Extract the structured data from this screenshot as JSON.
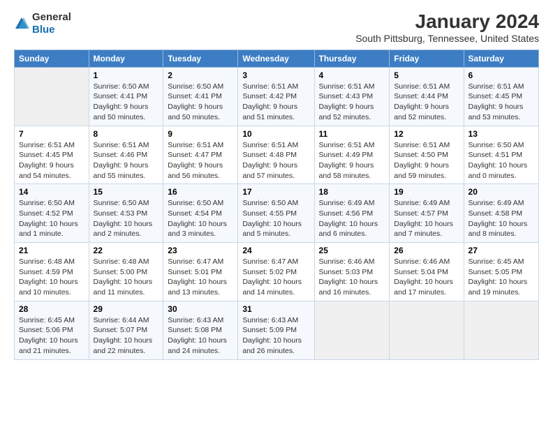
{
  "logo": {
    "general": "General",
    "blue": "Blue"
  },
  "title": "January 2024",
  "subtitle": "South Pittsburg, Tennessee, United States",
  "days_of_week": [
    "Sunday",
    "Monday",
    "Tuesday",
    "Wednesday",
    "Thursday",
    "Friday",
    "Saturday"
  ],
  "weeks": [
    [
      {
        "num": "",
        "sunrise": "",
        "sunset": "",
        "daylight": ""
      },
      {
        "num": "1",
        "sunrise": "Sunrise: 6:50 AM",
        "sunset": "Sunset: 4:41 PM",
        "daylight": "Daylight: 9 hours and 50 minutes."
      },
      {
        "num": "2",
        "sunrise": "Sunrise: 6:50 AM",
        "sunset": "Sunset: 4:41 PM",
        "daylight": "Daylight: 9 hours and 50 minutes."
      },
      {
        "num": "3",
        "sunrise": "Sunrise: 6:51 AM",
        "sunset": "Sunset: 4:42 PM",
        "daylight": "Daylight: 9 hours and 51 minutes."
      },
      {
        "num": "4",
        "sunrise": "Sunrise: 6:51 AM",
        "sunset": "Sunset: 4:43 PM",
        "daylight": "Daylight: 9 hours and 52 minutes."
      },
      {
        "num": "5",
        "sunrise": "Sunrise: 6:51 AM",
        "sunset": "Sunset: 4:44 PM",
        "daylight": "Daylight: 9 hours and 52 minutes."
      },
      {
        "num": "6",
        "sunrise": "Sunrise: 6:51 AM",
        "sunset": "Sunset: 4:45 PM",
        "daylight": "Daylight: 9 hours and 53 minutes."
      }
    ],
    [
      {
        "num": "7",
        "sunrise": "Sunrise: 6:51 AM",
        "sunset": "Sunset: 4:45 PM",
        "daylight": "Daylight: 9 hours and 54 minutes."
      },
      {
        "num": "8",
        "sunrise": "Sunrise: 6:51 AM",
        "sunset": "Sunset: 4:46 PM",
        "daylight": "Daylight: 9 hours and 55 minutes."
      },
      {
        "num": "9",
        "sunrise": "Sunrise: 6:51 AM",
        "sunset": "Sunset: 4:47 PM",
        "daylight": "Daylight: 9 hours and 56 minutes."
      },
      {
        "num": "10",
        "sunrise": "Sunrise: 6:51 AM",
        "sunset": "Sunset: 4:48 PM",
        "daylight": "Daylight: 9 hours and 57 minutes."
      },
      {
        "num": "11",
        "sunrise": "Sunrise: 6:51 AM",
        "sunset": "Sunset: 4:49 PM",
        "daylight": "Daylight: 9 hours and 58 minutes."
      },
      {
        "num": "12",
        "sunrise": "Sunrise: 6:51 AM",
        "sunset": "Sunset: 4:50 PM",
        "daylight": "Daylight: 9 hours and 59 minutes."
      },
      {
        "num": "13",
        "sunrise": "Sunrise: 6:50 AM",
        "sunset": "Sunset: 4:51 PM",
        "daylight": "Daylight: 10 hours and 0 minutes."
      }
    ],
    [
      {
        "num": "14",
        "sunrise": "Sunrise: 6:50 AM",
        "sunset": "Sunset: 4:52 PM",
        "daylight": "Daylight: 10 hours and 1 minute."
      },
      {
        "num": "15",
        "sunrise": "Sunrise: 6:50 AM",
        "sunset": "Sunset: 4:53 PM",
        "daylight": "Daylight: 10 hours and 2 minutes."
      },
      {
        "num": "16",
        "sunrise": "Sunrise: 6:50 AM",
        "sunset": "Sunset: 4:54 PM",
        "daylight": "Daylight: 10 hours and 3 minutes."
      },
      {
        "num": "17",
        "sunrise": "Sunrise: 6:50 AM",
        "sunset": "Sunset: 4:55 PM",
        "daylight": "Daylight: 10 hours and 5 minutes."
      },
      {
        "num": "18",
        "sunrise": "Sunrise: 6:49 AM",
        "sunset": "Sunset: 4:56 PM",
        "daylight": "Daylight: 10 hours and 6 minutes."
      },
      {
        "num": "19",
        "sunrise": "Sunrise: 6:49 AM",
        "sunset": "Sunset: 4:57 PM",
        "daylight": "Daylight: 10 hours and 7 minutes."
      },
      {
        "num": "20",
        "sunrise": "Sunrise: 6:49 AM",
        "sunset": "Sunset: 4:58 PM",
        "daylight": "Daylight: 10 hours and 8 minutes."
      }
    ],
    [
      {
        "num": "21",
        "sunrise": "Sunrise: 6:48 AM",
        "sunset": "Sunset: 4:59 PM",
        "daylight": "Daylight: 10 hours and 10 minutes."
      },
      {
        "num": "22",
        "sunrise": "Sunrise: 6:48 AM",
        "sunset": "Sunset: 5:00 PM",
        "daylight": "Daylight: 10 hours and 11 minutes."
      },
      {
        "num": "23",
        "sunrise": "Sunrise: 6:47 AM",
        "sunset": "Sunset: 5:01 PM",
        "daylight": "Daylight: 10 hours and 13 minutes."
      },
      {
        "num": "24",
        "sunrise": "Sunrise: 6:47 AM",
        "sunset": "Sunset: 5:02 PM",
        "daylight": "Daylight: 10 hours and 14 minutes."
      },
      {
        "num": "25",
        "sunrise": "Sunrise: 6:46 AM",
        "sunset": "Sunset: 5:03 PM",
        "daylight": "Daylight: 10 hours and 16 minutes."
      },
      {
        "num": "26",
        "sunrise": "Sunrise: 6:46 AM",
        "sunset": "Sunset: 5:04 PM",
        "daylight": "Daylight: 10 hours and 17 minutes."
      },
      {
        "num": "27",
        "sunrise": "Sunrise: 6:45 AM",
        "sunset": "Sunset: 5:05 PM",
        "daylight": "Daylight: 10 hours and 19 minutes."
      }
    ],
    [
      {
        "num": "28",
        "sunrise": "Sunrise: 6:45 AM",
        "sunset": "Sunset: 5:06 PM",
        "daylight": "Daylight: 10 hours and 21 minutes."
      },
      {
        "num": "29",
        "sunrise": "Sunrise: 6:44 AM",
        "sunset": "Sunset: 5:07 PM",
        "daylight": "Daylight: 10 hours and 22 minutes."
      },
      {
        "num": "30",
        "sunrise": "Sunrise: 6:43 AM",
        "sunset": "Sunset: 5:08 PM",
        "daylight": "Daylight: 10 hours and 24 minutes."
      },
      {
        "num": "31",
        "sunrise": "Sunrise: 6:43 AM",
        "sunset": "Sunset: 5:09 PM",
        "daylight": "Daylight: 10 hours and 26 minutes."
      },
      {
        "num": "",
        "sunrise": "",
        "sunset": "",
        "daylight": ""
      },
      {
        "num": "",
        "sunrise": "",
        "sunset": "",
        "daylight": ""
      },
      {
        "num": "",
        "sunrise": "",
        "sunset": "",
        "daylight": ""
      }
    ]
  ]
}
